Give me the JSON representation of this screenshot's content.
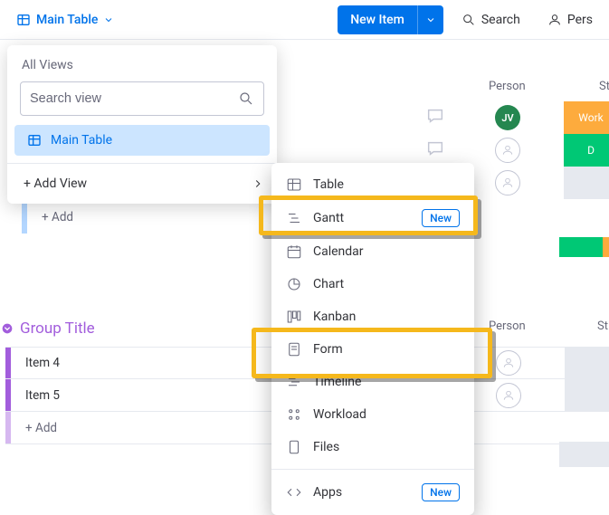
{
  "topbar": {
    "active_view": "Main Table",
    "new_item_label": "New Item",
    "search_label": "Search",
    "person_label": "Pers"
  },
  "columns": {
    "person": "Person",
    "status": "St"
  },
  "rows_bg": [
    {
      "avatar": "JV",
      "avatar_type": "green",
      "status_color": "#fdab3d",
      "status_text": "Work"
    },
    {
      "avatar": "",
      "avatar_type": "gray",
      "status_color": "#00c875",
      "status_text": "D"
    },
    {
      "avatar": "",
      "avatar_type": "gray",
      "status_color": "#e6e9ef",
      "status_text": ""
    }
  ],
  "group1": {
    "add_label": "+ Add"
  },
  "group2": {
    "title": "Group Title",
    "columns": {
      "person": "Person",
      "status": "St"
    },
    "items": [
      {
        "name": "Item 4"
      },
      {
        "name": "Item 5"
      }
    ],
    "add_label": "+ Add"
  },
  "views_panel": {
    "all_views_label": "All Views",
    "search_placeholder": "Search view",
    "items": [
      {
        "label": "Main Table",
        "active": true
      }
    ],
    "add_view_label": "+ Add View"
  },
  "submenu": {
    "items": [
      {
        "icon": "table",
        "label": "Table"
      },
      {
        "icon": "gantt",
        "label": "Gantt",
        "badge": "New"
      },
      {
        "icon": "calendar",
        "label": "Calendar"
      },
      {
        "icon": "chart",
        "label": "Chart"
      },
      {
        "icon": "kanban",
        "label": "Kanban"
      },
      {
        "icon": "form",
        "label": "Form"
      },
      {
        "icon": "timeline",
        "label": "Timeline"
      },
      {
        "icon": "workload",
        "label": "Workload"
      },
      {
        "icon": "files",
        "label": "Files"
      }
    ],
    "apps": {
      "label": "Apps",
      "badge": "New"
    }
  }
}
